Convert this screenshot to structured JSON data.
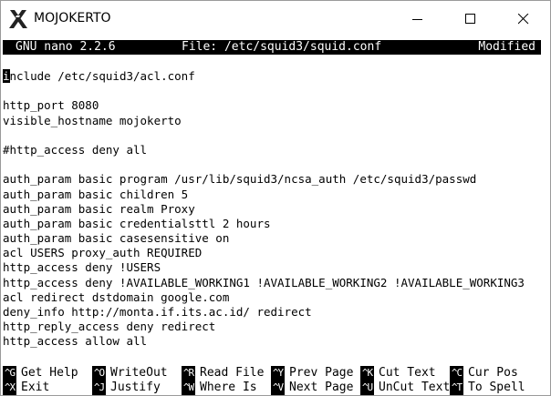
{
  "window": {
    "title": "MOJOKERTO",
    "icon": "x-server-icon",
    "controls": [
      "minimize-icon",
      "maximize-icon",
      "close-icon"
    ]
  },
  "nano": {
    "version": "GNU nano 2.2.6",
    "file_label": "File: /etc/squid3/squid.conf",
    "modified": "Modified"
  },
  "editor": {
    "cursor_char": "i",
    "first_line_rest": "nclude /etc/squid3/acl.conf",
    "lines": [
      "",
      "http_port 8080",
      "visible_hostname mojokerto",
      "",
      "#http_access deny all",
      "",
      "auth_param basic program /usr/lib/squid3/ncsa_auth /etc/squid3/passwd",
      "auth_param basic children 5",
      "auth_param basic realm Proxy",
      "auth_param basic credentialsttl 2 hours",
      "auth_param basic casesensitive on",
      "acl USERS proxy_auth REQUIRED",
      "http_access deny !USERS",
      "http_access deny !AVAILABLE_WORKING1 !AVAILABLE_WORKING2 !AVAILABLE_WORKING3",
      "acl redirect dstdomain google.com",
      "deny_info http://monta.if.its.ac.id/ redirect",
      "http_reply_access deny redirect",
      "http_access allow all"
    ]
  },
  "shortcuts": {
    "row1": [
      {
        "key": "^G",
        "label": "Get Help"
      },
      {
        "key": "^O",
        "label": "WriteOut"
      },
      {
        "key": "^R",
        "label": "Read File"
      },
      {
        "key": "^Y",
        "label": "Prev Page"
      },
      {
        "key": "^K",
        "label": "Cut Text"
      },
      {
        "key": "^C",
        "label": "Cur Pos"
      }
    ],
    "row2": [
      {
        "key": "^X",
        "label": "Exit"
      },
      {
        "key": "^J",
        "label": "Justify"
      },
      {
        "key": "^W",
        "label": "Where Is"
      },
      {
        "key": "^V",
        "label": "Next Page"
      },
      {
        "key": "^U",
        "label": "UnCut Text"
      },
      {
        "key": "^T",
        "label": "To Spell"
      }
    ]
  }
}
